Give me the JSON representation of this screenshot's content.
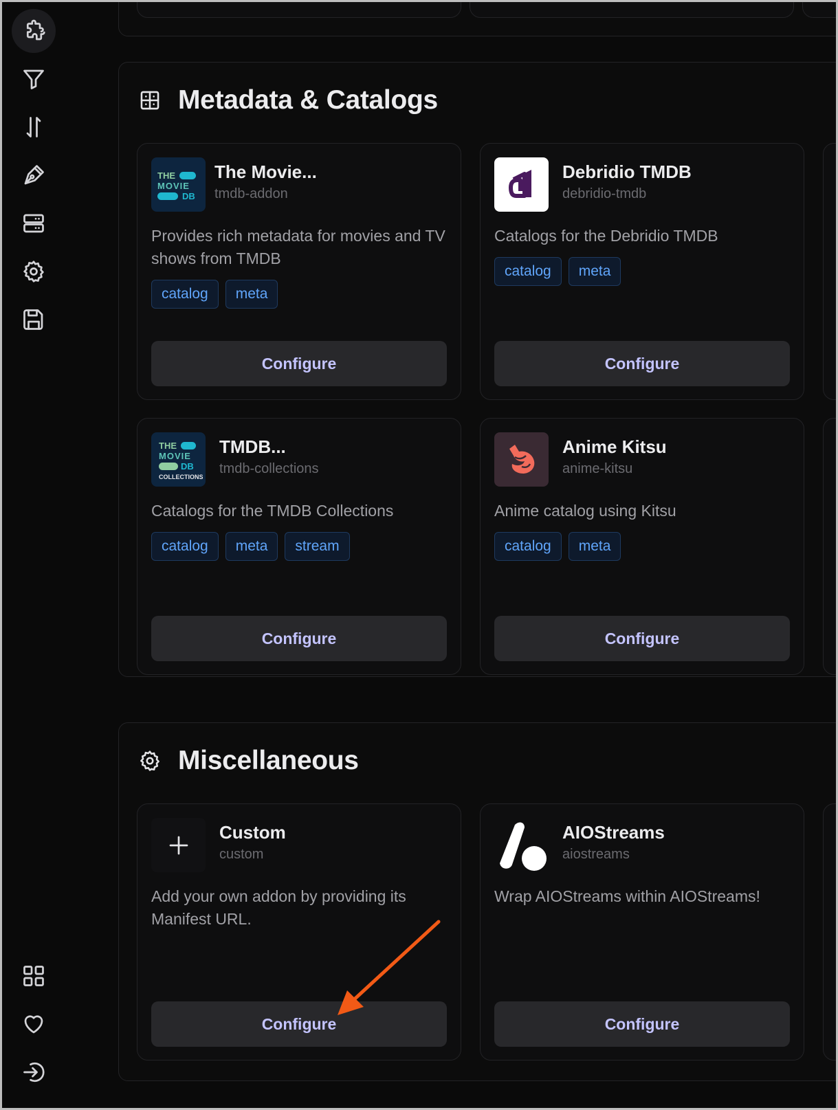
{
  "sidebar": {
    "items": [
      {
        "name": "puzzle-icon"
      },
      {
        "name": "filter-icon"
      },
      {
        "name": "sort-arrows-icon"
      },
      {
        "name": "pen-nib-icon"
      },
      {
        "name": "server-icon"
      },
      {
        "name": "gear-icon"
      },
      {
        "name": "save-icon"
      },
      {
        "name": "grid-icon"
      },
      {
        "name": "heart-icon"
      },
      {
        "name": "sign-in-icon"
      }
    ]
  },
  "sections": {
    "metadata": {
      "title": "Metadata & Catalogs",
      "cards": [
        {
          "title": "The Movie...",
          "id": "tmdb-addon",
          "description": "Provides rich metadata for movies and TV shows from TMDB",
          "tags": [
            "catalog",
            "meta"
          ],
          "button": "Configure"
        },
        {
          "title": "Debridio TMDB",
          "id": "debridio-tmdb",
          "description": "Catalogs for the Debridio TMDB",
          "tags": [
            "catalog",
            "meta"
          ],
          "button": "Configure"
        },
        {
          "title": "TMDB...",
          "id": "tmdb-collections",
          "description": "Catalogs for the TMDB Collections",
          "tags": [
            "catalog",
            "meta",
            "stream"
          ],
          "button": "Configure"
        },
        {
          "title": "Anime Kitsu",
          "id": "anime-kitsu",
          "description": "Anime catalog using Kitsu",
          "tags": [
            "catalog",
            "meta"
          ],
          "button": "Configure"
        }
      ]
    },
    "misc": {
      "title": "Miscellaneous",
      "cards": [
        {
          "title": "Custom",
          "id": "custom",
          "description": "Add your own addon by providing its Manifest URL.",
          "button": "Configure"
        },
        {
          "title": "AIOStreams",
          "id": "aiostreams",
          "description": "Wrap AIOStreams within AIOStreams!",
          "button": "Configure"
        }
      ]
    }
  },
  "logos": {
    "tmdb_line1": "THE",
    "tmdb_line2": "MOVIE",
    "tmdb_line3": "DB",
    "tmdb_collections": "COLLECTIONS"
  },
  "colors": {
    "accent": "#c4c4ff",
    "tag_text": "#60a5fa",
    "annotation_arrow": "#f25a16",
    "tmdb_teal": "#1fb8d0",
    "tmdb_green": "#90cea1"
  }
}
